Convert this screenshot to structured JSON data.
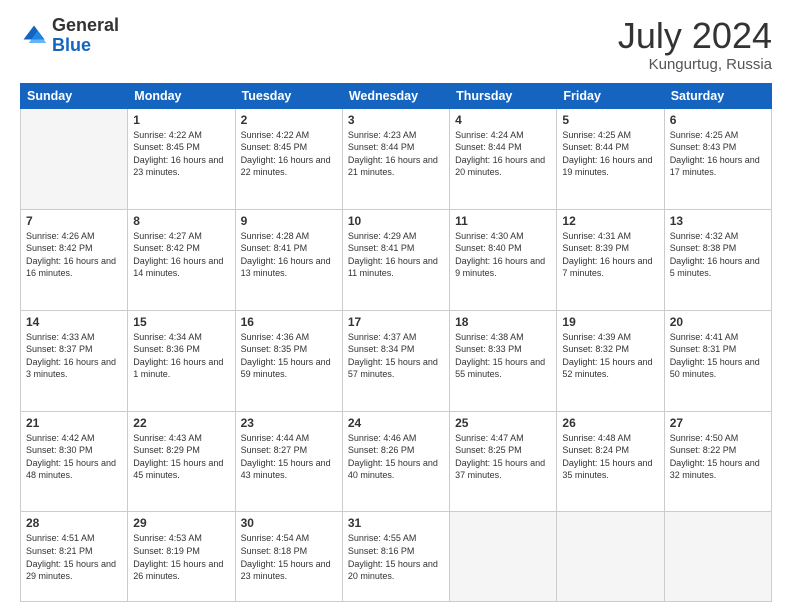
{
  "logo": {
    "general": "General",
    "blue": "Blue"
  },
  "header": {
    "month_year": "July 2024",
    "location": "Kungurtug, Russia"
  },
  "weekdays": [
    "Sunday",
    "Monday",
    "Tuesday",
    "Wednesday",
    "Thursday",
    "Friday",
    "Saturday"
  ],
  "weeks": [
    [
      {
        "day": "",
        "sunrise": "",
        "sunset": "",
        "daylight": ""
      },
      {
        "day": "1",
        "sunrise": "Sunrise: 4:22 AM",
        "sunset": "Sunset: 8:45 PM",
        "daylight": "Daylight: 16 hours and 23 minutes."
      },
      {
        "day": "2",
        "sunrise": "Sunrise: 4:22 AM",
        "sunset": "Sunset: 8:45 PM",
        "daylight": "Daylight: 16 hours and 22 minutes."
      },
      {
        "day": "3",
        "sunrise": "Sunrise: 4:23 AM",
        "sunset": "Sunset: 8:44 PM",
        "daylight": "Daylight: 16 hours and 21 minutes."
      },
      {
        "day": "4",
        "sunrise": "Sunrise: 4:24 AM",
        "sunset": "Sunset: 8:44 PM",
        "daylight": "Daylight: 16 hours and 20 minutes."
      },
      {
        "day": "5",
        "sunrise": "Sunrise: 4:25 AM",
        "sunset": "Sunset: 8:44 PM",
        "daylight": "Daylight: 16 hours and 19 minutes."
      },
      {
        "day": "6",
        "sunrise": "Sunrise: 4:25 AM",
        "sunset": "Sunset: 8:43 PM",
        "daylight": "Daylight: 16 hours and 17 minutes."
      }
    ],
    [
      {
        "day": "7",
        "sunrise": "Sunrise: 4:26 AM",
        "sunset": "Sunset: 8:42 PM",
        "daylight": "Daylight: 16 hours and 16 minutes."
      },
      {
        "day": "8",
        "sunrise": "Sunrise: 4:27 AM",
        "sunset": "Sunset: 8:42 PM",
        "daylight": "Daylight: 16 hours and 14 minutes."
      },
      {
        "day": "9",
        "sunrise": "Sunrise: 4:28 AM",
        "sunset": "Sunset: 8:41 PM",
        "daylight": "Daylight: 16 hours and 13 minutes."
      },
      {
        "day": "10",
        "sunrise": "Sunrise: 4:29 AM",
        "sunset": "Sunset: 8:41 PM",
        "daylight": "Daylight: 16 hours and 11 minutes."
      },
      {
        "day": "11",
        "sunrise": "Sunrise: 4:30 AM",
        "sunset": "Sunset: 8:40 PM",
        "daylight": "Daylight: 16 hours and 9 minutes."
      },
      {
        "day": "12",
        "sunrise": "Sunrise: 4:31 AM",
        "sunset": "Sunset: 8:39 PM",
        "daylight": "Daylight: 16 hours and 7 minutes."
      },
      {
        "day": "13",
        "sunrise": "Sunrise: 4:32 AM",
        "sunset": "Sunset: 8:38 PM",
        "daylight": "Daylight: 16 hours and 5 minutes."
      }
    ],
    [
      {
        "day": "14",
        "sunrise": "Sunrise: 4:33 AM",
        "sunset": "Sunset: 8:37 PM",
        "daylight": "Daylight: 16 hours and 3 minutes."
      },
      {
        "day": "15",
        "sunrise": "Sunrise: 4:34 AM",
        "sunset": "Sunset: 8:36 PM",
        "daylight": "Daylight: 16 hours and 1 minute."
      },
      {
        "day": "16",
        "sunrise": "Sunrise: 4:36 AM",
        "sunset": "Sunset: 8:35 PM",
        "daylight": "Daylight: 15 hours and 59 minutes."
      },
      {
        "day": "17",
        "sunrise": "Sunrise: 4:37 AM",
        "sunset": "Sunset: 8:34 PM",
        "daylight": "Daylight: 15 hours and 57 minutes."
      },
      {
        "day": "18",
        "sunrise": "Sunrise: 4:38 AM",
        "sunset": "Sunset: 8:33 PM",
        "daylight": "Daylight: 15 hours and 55 minutes."
      },
      {
        "day": "19",
        "sunrise": "Sunrise: 4:39 AM",
        "sunset": "Sunset: 8:32 PM",
        "daylight": "Daylight: 15 hours and 52 minutes."
      },
      {
        "day": "20",
        "sunrise": "Sunrise: 4:41 AM",
        "sunset": "Sunset: 8:31 PM",
        "daylight": "Daylight: 15 hours and 50 minutes."
      }
    ],
    [
      {
        "day": "21",
        "sunrise": "Sunrise: 4:42 AM",
        "sunset": "Sunset: 8:30 PM",
        "daylight": "Daylight: 15 hours and 48 minutes."
      },
      {
        "day": "22",
        "sunrise": "Sunrise: 4:43 AM",
        "sunset": "Sunset: 8:29 PM",
        "daylight": "Daylight: 15 hours and 45 minutes."
      },
      {
        "day": "23",
        "sunrise": "Sunrise: 4:44 AM",
        "sunset": "Sunset: 8:27 PM",
        "daylight": "Daylight: 15 hours and 43 minutes."
      },
      {
        "day": "24",
        "sunrise": "Sunrise: 4:46 AM",
        "sunset": "Sunset: 8:26 PM",
        "daylight": "Daylight: 15 hours and 40 minutes."
      },
      {
        "day": "25",
        "sunrise": "Sunrise: 4:47 AM",
        "sunset": "Sunset: 8:25 PM",
        "daylight": "Daylight: 15 hours and 37 minutes."
      },
      {
        "day": "26",
        "sunrise": "Sunrise: 4:48 AM",
        "sunset": "Sunset: 8:24 PM",
        "daylight": "Daylight: 15 hours and 35 minutes."
      },
      {
        "day": "27",
        "sunrise": "Sunrise: 4:50 AM",
        "sunset": "Sunset: 8:22 PM",
        "daylight": "Daylight: 15 hours and 32 minutes."
      }
    ],
    [
      {
        "day": "28",
        "sunrise": "Sunrise: 4:51 AM",
        "sunset": "Sunset: 8:21 PM",
        "daylight": "Daylight: 15 hours and 29 minutes."
      },
      {
        "day": "29",
        "sunrise": "Sunrise: 4:53 AM",
        "sunset": "Sunset: 8:19 PM",
        "daylight": "Daylight: 15 hours and 26 minutes."
      },
      {
        "day": "30",
        "sunrise": "Sunrise: 4:54 AM",
        "sunset": "Sunset: 8:18 PM",
        "daylight": "Daylight: 15 hours and 23 minutes."
      },
      {
        "day": "31",
        "sunrise": "Sunrise: 4:55 AM",
        "sunset": "Sunset: 8:16 PM",
        "daylight": "Daylight: 15 hours and 20 minutes."
      },
      {
        "day": "",
        "sunrise": "",
        "sunset": "",
        "daylight": ""
      },
      {
        "day": "",
        "sunrise": "",
        "sunset": "",
        "daylight": ""
      },
      {
        "day": "",
        "sunrise": "",
        "sunset": "",
        "daylight": ""
      }
    ]
  ]
}
